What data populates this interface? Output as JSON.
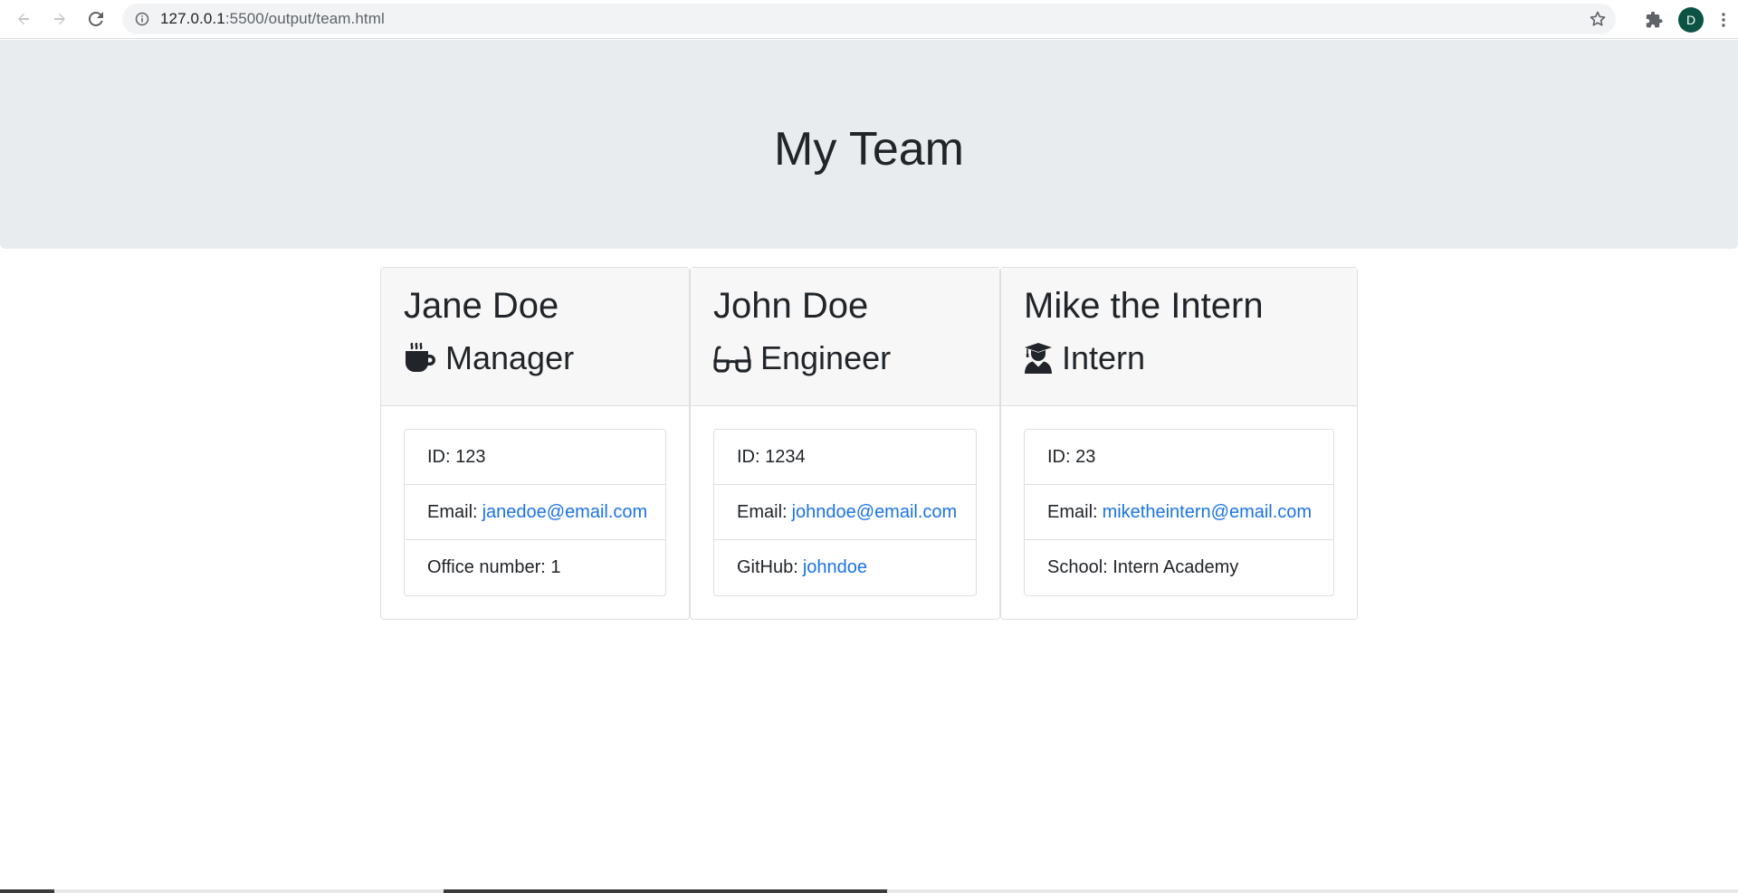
{
  "browser": {
    "url_host": "127.0.0.1",
    "url_path": ":5500/output/team.html",
    "avatar_letter": "D"
  },
  "page": {
    "title": "My Team"
  },
  "team": [
    {
      "name": "Jane Doe",
      "role": "Manager",
      "role_icon": "mug-hot-icon",
      "id_label": "ID: 123",
      "email_prefix": "Email:",
      "email": "janedoe@email.com",
      "extra_prefix": "Office number: 1",
      "extra_link": ""
    },
    {
      "name": "John Doe",
      "role": "Engineer",
      "role_icon": "glasses-icon",
      "id_label": "ID: 1234",
      "email_prefix": "Email:",
      "email": "johndoe@email.com",
      "extra_prefix": "GitHub:",
      "extra_link": "johndoe"
    },
    {
      "name": "Mike the Intern",
      "role": "Intern",
      "role_icon": "user-graduate-icon",
      "id_label": "ID: 23",
      "email_prefix": "Email:",
      "email": "miketheintern@email.com",
      "extra_prefix": "School: Intern Academy",
      "extra_link": ""
    }
  ]
}
